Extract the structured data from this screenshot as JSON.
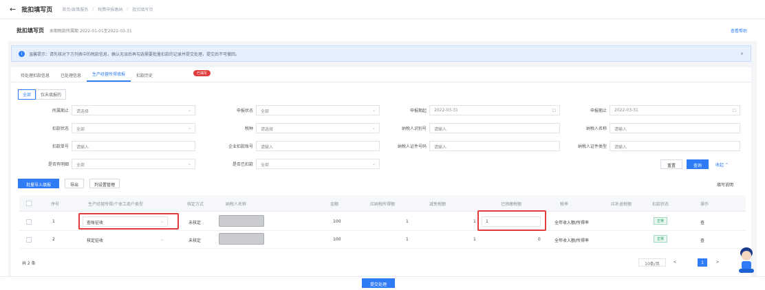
{
  "topbar": {
    "back": "←",
    "title": "批扣填写页",
    "crumbs": [
      "首页/政策服务",
      "税费申报缴纳",
      "批扣填写页"
    ]
  },
  "header": {
    "title": "批扣填写页",
    "subtitle": "本期税款所属期 2022-01-01至2022-03-31",
    "link": "查看帮助"
  },
  "notice": {
    "text": "温馨提示：请先核对下方列表中的税款信息，确认无误后再勾选需要批量扣款的记录并提交处理，提交后不可撤回。",
    "close": "×"
  },
  "tabs": [
    {
      "label": "待处理扣款信息"
    },
    {
      "label": "已处理信息"
    },
    {
      "label": "生产经营所得填报"
    },
    {
      "label": "扣款历史"
    }
  ],
  "tab_badge": "已填写",
  "subtabs": [
    "全部",
    "仅未填报的"
  ],
  "filters": {
    "row1": [
      {
        "label": "所属期止",
        "value": "请选择"
      },
      {
        "label": "申报状态",
        "value": "全部"
      },
      {
        "label": "申报期起",
        "value": "2022-03-31"
      },
      {
        "label": "申报期止",
        "value": "2022-03-31"
      }
    ],
    "row2": [
      {
        "label": "扣款状态",
        "value": "全部"
      },
      {
        "label": "税种",
        "value": "请选择"
      },
      {
        "label": "纳税人识别号",
        "value": "请输入"
      },
      {
        "label": "纳税人名称",
        "value": "请输入"
      }
    ],
    "row3": [
      {
        "label": "扣款单号",
        "value": "请输入"
      },
      {
        "label": "企业扣款账号",
        "value": "请输入"
      },
      {
        "label": "纳税人证件号码",
        "value": "请输入"
      },
      {
        "label": "纳税人证件类型",
        "value": "请输入"
      }
    ],
    "row4": [
      {
        "label": "是否有明细",
        "value": "全部"
      },
      {
        "label": "是否已扣款",
        "value": "全部"
      }
    ],
    "reset": "重置",
    "search": "查询",
    "collapse": "收起 ^"
  },
  "toolbar": {
    "batch": "批量导入填报",
    "export": "导出",
    "config": "列设置管理",
    "right_link": "填写说明"
  },
  "table": {
    "headers": [
      "序号",
      "生产经营所得/个体工商户类型",
      "核定方式",
      "纳税人名称",
      "金额",
      "应纳税所得额",
      "减免税额",
      "已预缴税额",
      "税率",
      "应补退税额",
      "扣款状态",
      "操作"
    ],
    "rows": [
      {
        "no": "1",
        "select": "查账征收",
        "method": "未核定",
        "amount": "100",
        "v1": "1",
        "v2": "1",
        "input": "1",
        "rate": "全年收入额/所得率",
        "status": "正常",
        "op": "查"
      },
      {
        "no": "2",
        "select": "核定征收",
        "method": "未核定",
        "amount": "100",
        "v1": "1",
        "v2": "1",
        "input": "0",
        "rate": "全年收入额/所得率",
        "status": "正常",
        "op": "查"
      }
    ]
  },
  "pager": {
    "total": "共 2 条",
    "size": "10条/页",
    "prev": "<",
    "current": "1",
    "next": ">"
  },
  "footer": {
    "submit": "提交处理"
  },
  "colors": {
    "primary": "#2f7cf6",
    "highlight": "#e03a3a",
    "ok": "#18a058"
  }
}
